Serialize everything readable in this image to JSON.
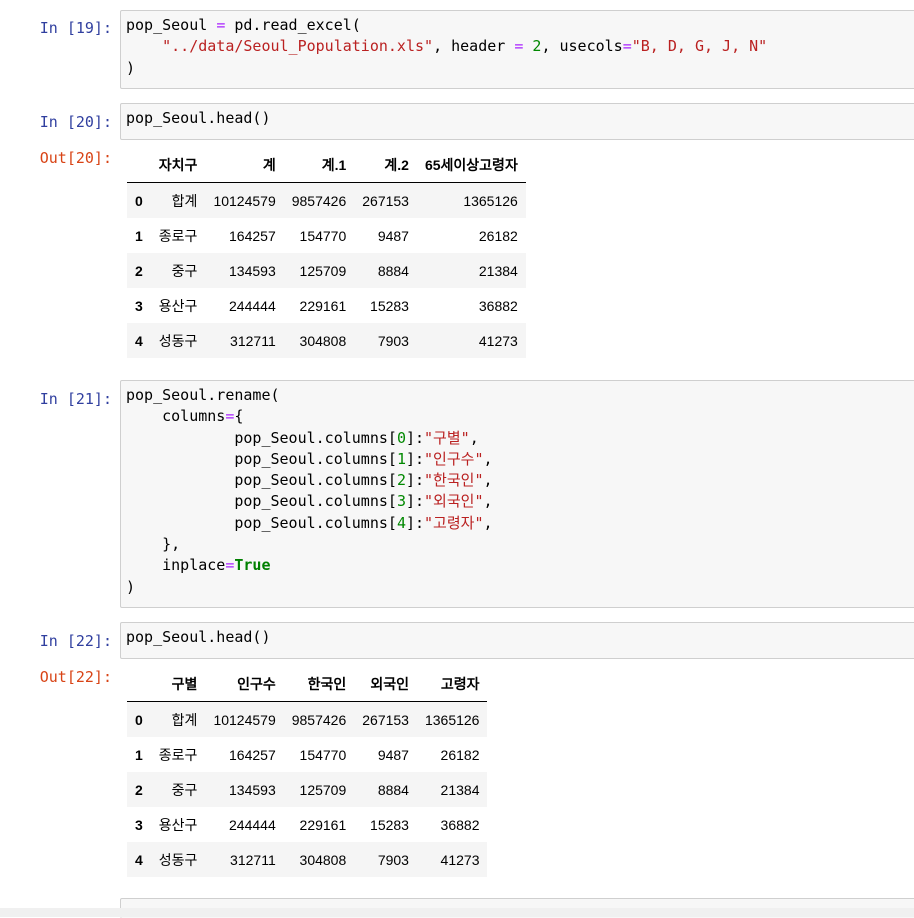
{
  "cells": [
    {
      "prompt": "In [19]:",
      "code_lines": [
        [
          [
            "pop_Seoul ",
            ""
          ],
          [
            "=",
            "o"
          ],
          [
            " pd.read_excel(",
            ""
          ]
        ],
        [
          [
            "    ",
            ""
          ],
          [
            "\"../data/Seoul_Population.xls\"",
            "s"
          ],
          [
            ", header ",
            ""
          ],
          [
            "=",
            "o"
          ],
          [
            " ",
            ""
          ],
          [
            "2",
            "n"
          ],
          [
            ", usecols",
            ""
          ],
          [
            "=",
            "o"
          ],
          [
            "\"B, D, G, J, N\"",
            "s"
          ]
        ],
        [
          [
            ")",
            ""
          ]
        ]
      ]
    },
    {
      "prompt": "In [20]:",
      "code_lines": [
        [
          [
            "pop_Seoul.head()",
            ""
          ]
        ]
      ],
      "out_prompt": "Out[20]:",
      "table": {
        "columns": [
          "",
          "자치구",
          "계",
          "계.1",
          "계.2",
          "65세이상고령자"
        ],
        "rows": [
          [
            "0",
            "합계",
            "10124579",
            "9857426",
            "267153",
            "1365126"
          ],
          [
            "1",
            "종로구",
            "164257",
            "154770",
            "9487",
            "26182"
          ],
          [
            "2",
            "중구",
            "134593",
            "125709",
            "8884",
            "21384"
          ],
          [
            "3",
            "용산구",
            "244444",
            "229161",
            "15283",
            "36882"
          ],
          [
            "4",
            "성동구",
            "312711",
            "304808",
            "7903",
            "41273"
          ]
        ]
      }
    },
    {
      "prompt": "In [21]:",
      "code_lines": [
        [
          [
            "pop_Seoul.rename(",
            ""
          ]
        ],
        [
          [
            "    columns",
            ""
          ],
          [
            "=",
            "o"
          ],
          [
            "{",
            ""
          ]
        ],
        [
          [
            "            pop_Seoul.columns[",
            ""
          ],
          [
            "0",
            "n"
          ],
          [
            "]:",
            ""
          ],
          [
            "\"구별\"",
            "s"
          ],
          [
            ",",
            ""
          ]
        ],
        [
          [
            "            pop_Seoul.columns[",
            ""
          ],
          [
            "1",
            "n"
          ],
          [
            "]:",
            ""
          ],
          [
            "\"인구수\"",
            "s"
          ],
          [
            ",",
            ""
          ]
        ],
        [
          [
            "            pop_Seoul.columns[",
            ""
          ],
          [
            "2",
            "n"
          ],
          [
            "]:",
            ""
          ],
          [
            "\"한국인\"",
            "s"
          ],
          [
            ",",
            ""
          ]
        ],
        [
          [
            "            pop_Seoul.columns[",
            ""
          ],
          [
            "3",
            "n"
          ],
          [
            "]:",
            ""
          ],
          [
            "\"외국인\"",
            "s"
          ],
          [
            ",",
            ""
          ]
        ],
        [
          [
            "            pop_Seoul.columns[",
            ""
          ],
          [
            "4",
            "n"
          ],
          [
            "]:",
            ""
          ],
          [
            "\"고령자\"",
            "s"
          ],
          [
            ",",
            ""
          ]
        ],
        [
          [
            "    },",
            ""
          ]
        ],
        [
          [
            "    inplace",
            ""
          ],
          [
            "=",
            "o"
          ],
          [
            "True",
            "k"
          ]
        ],
        [
          [
            ")",
            ""
          ]
        ]
      ]
    },
    {
      "prompt": "In [22]:",
      "code_lines": [
        [
          [
            "pop_Seoul.head()",
            ""
          ]
        ]
      ],
      "out_prompt": "Out[22]:",
      "table": {
        "columns": [
          "",
          "구별",
          "인구수",
          "한국인",
          "외국인",
          "고령자"
        ],
        "rows": [
          [
            "0",
            "합계",
            "10124579",
            "9857426",
            "267153",
            "1365126"
          ],
          [
            "1",
            "종로구",
            "164257",
            "154770",
            "9487",
            "26182"
          ],
          [
            "2",
            "중구",
            "134593",
            "125709",
            "8884",
            "21384"
          ],
          [
            "3",
            "용산구",
            "244444",
            "229161",
            "15283",
            "36882"
          ],
          [
            "4",
            "성동구",
            "312711",
            "304808",
            "7903",
            "41273"
          ]
        ]
      }
    }
  ]
}
